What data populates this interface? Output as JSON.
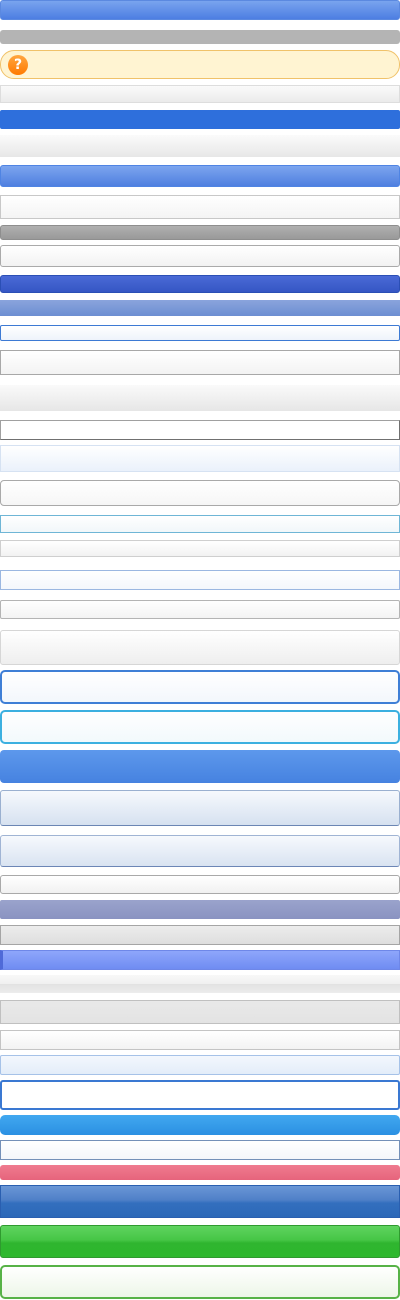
{
  "title": "",
  "help_icon": {
    "glyph": "?",
    "name": "question-icon",
    "color": "#ff7f00"
  },
  "bars": [
    {
      "name": "bar-blue-gradient-1"
    },
    {
      "name": "bar-gray-solid-1"
    },
    {
      "name": "bar-yellow-help"
    },
    {
      "name": "bar-light-gray-1"
    },
    {
      "name": "bar-blue-solid-1"
    },
    {
      "name": "bar-light-gray-2"
    },
    {
      "name": "bar-blue-gradient-2"
    },
    {
      "name": "bar-white-outline-1"
    },
    {
      "name": "bar-gray-solid-2"
    },
    {
      "name": "bar-white-outline-2"
    },
    {
      "name": "bar-blue-dark-1"
    },
    {
      "name": "bar-blue-muted-1"
    },
    {
      "name": "bar-white-blue-border-1"
    },
    {
      "name": "bar-white-outline-3"
    },
    {
      "name": "bar-light-gray-3"
    },
    {
      "name": "bar-white-outline-4"
    },
    {
      "name": "bar-very-light-blue-1"
    },
    {
      "name": "bar-white-rounded-1"
    },
    {
      "name": "bar-white-teal-border-1"
    },
    {
      "name": "bar-white-outline-5"
    },
    {
      "name": "bar-white-blue-border-2"
    },
    {
      "name": "bar-white-outline-6"
    },
    {
      "name": "bar-white-tall-1"
    },
    {
      "name": "bar-white-blue-rounded-1"
    },
    {
      "name": "bar-white-cyan-rounded-1"
    },
    {
      "name": "bar-blue-bright-1"
    },
    {
      "name": "bar-light-blue-gradient-1"
    },
    {
      "name": "bar-light-blue-gradient-2"
    },
    {
      "name": "bar-white-rounded-2"
    },
    {
      "name": "bar-slate-blue-1"
    },
    {
      "name": "bar-gray-light-4"
    },
    {
      "name": "bar-periwinkle-1"
    },
    {
      "name": "bar-light-gray-5"
    },
    {
      "name": "bar-gray-light-6"
    },
    {
      "name": "bar-white-outline-7"
    },
    {
      "name": "bar-very-light-blue-2"
    },
    {
      "name": "bar-white-blue-border-3"
    },
    {
      "name": "bar-blue-bright-2"
    },
    {
      "name": "bar-white-outline-8"
    },
    {
      "name": "bar-pink-1"
    },
    {
      "name": "bar-blue-dark-gradient-1"
    },
    {
      "name": "bar-green-1"
    },
    {
      "name": "bar-white-green-border-1"
    }
  ]
}
